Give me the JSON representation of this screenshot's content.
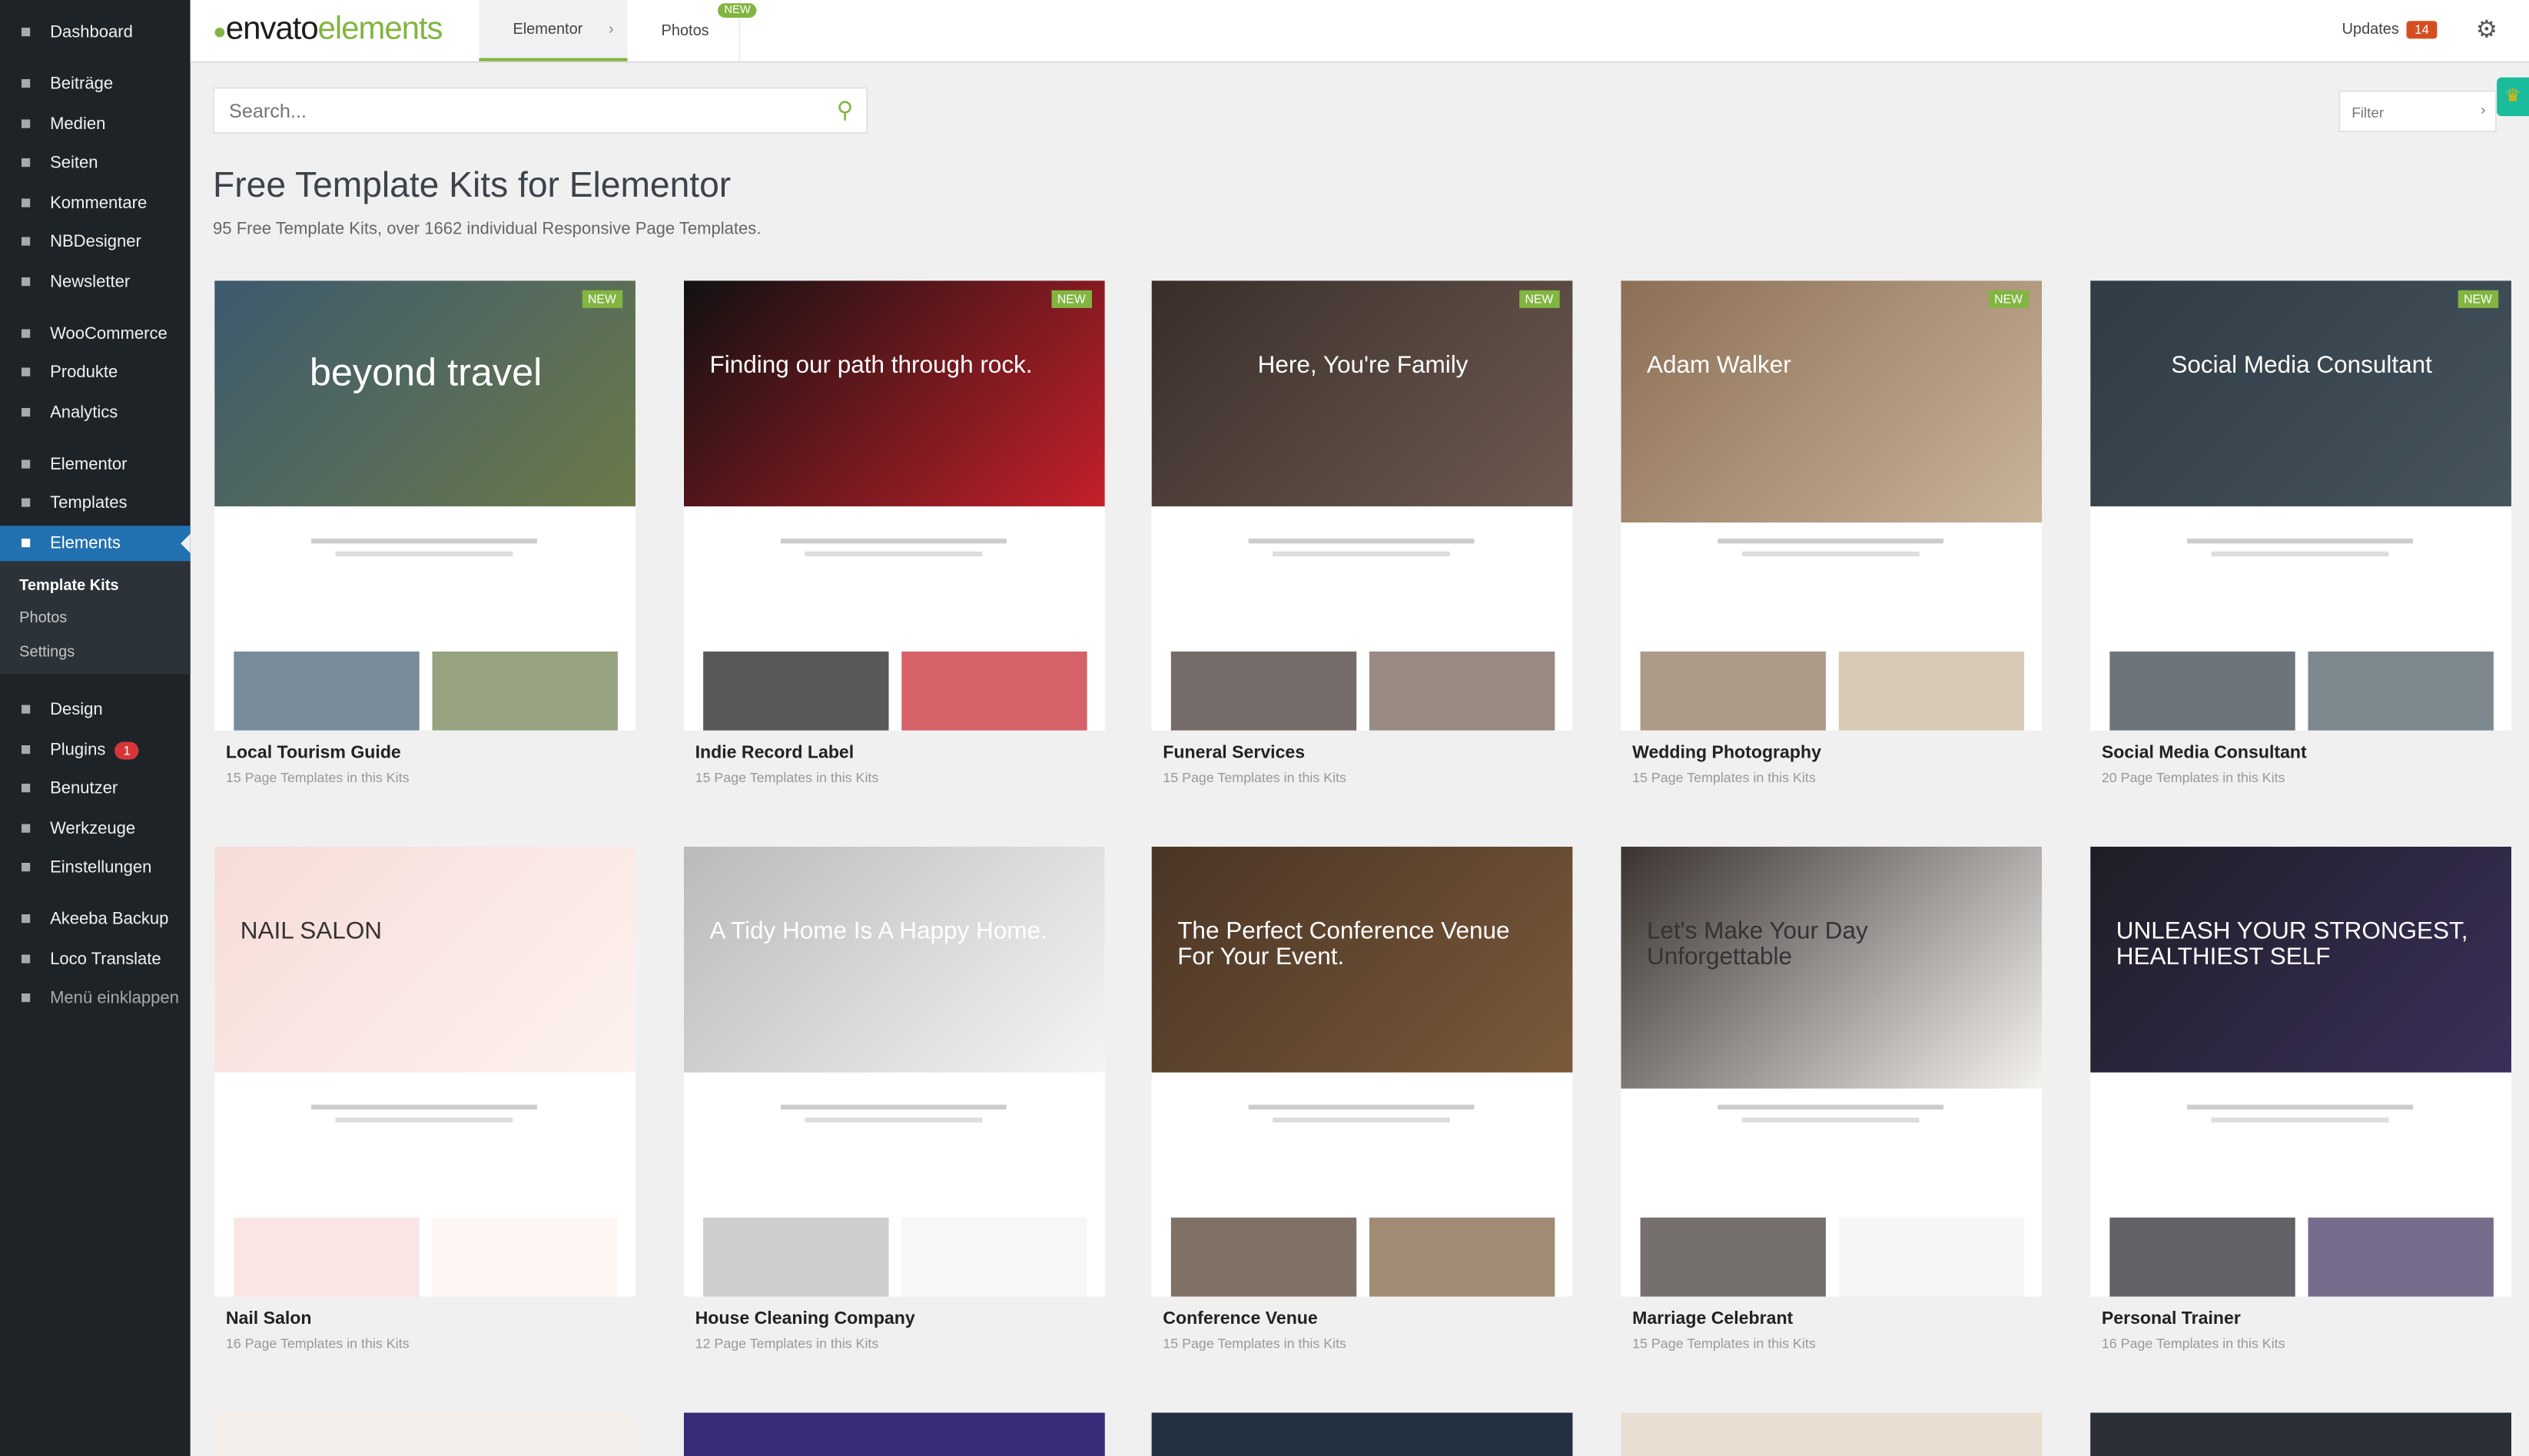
{
  "sidebar": {
    "items": [
      {
        "label": "Dashboard",
        "icon": "dashboard-icon"
      },
      {
        "label": "Beiträge",
        "icon": "pin-icon"
      },
      {
        "label": "Medien",
        "icon": "media-icon"
      },
      {
        "label": "Seiten",
        "icon": "pages-icon"
      },
      {
        "label": "Kommentare",
        "icon": "comment-icon"
      },
      {
        "label": "NBDesigner",
        "icon": "nb-icon"
      },
      {
        "label": "Newsletter",
        "icon": "mail-icon"
      },
      {
        "label": "WooCommerce",
        "icon": "woo-icon"
      },
      {
        "label": "Produkte",
        "icon": "box-icon"
      },
      {
        "label": "Analytics",
        "icon": "bar-chart-icon"
      },
      {
        "label": "Elementor",
        "icon": "elementor-icon"
      },
      {
        "label": "Templates",
        "icon": "folder-icon"
      },
      {
        "label": "Elements",
        "icon": "leaf-icon"
      },
      {
        "label": "Design",
        "icon": "brush-icon"
      },
      {
        "label": "Plugins",
        "icon": "plug-icon",
        "badge": "1"
      },
      {
        "label": "Benutzer",
        "icon": "user-icon"
      },
      {
        "label": "Werkzeuge",
        "icon": "wrench-icon"
      },
      {
        "label": "Einstellungen",
        "icon": "settings-icon"
      },
      {
        "label": "Akeeba Backup",
        "icon": "backup-icon"
      },
      {
        "label": "Loco Translate",
        "icon": "translate-icon"
      },
      {
        "label": "Menü einklappen",
        "icon": "collapse-icon"
      }
    ],
    "submenu": [
      "Template Kits",
      "Photos",
      "Settings"
    ]
  },
  "header": {
    "logo_a": "envato",
    "logo_b": "elements",
    "tabs": [
      "Elementor",
      "Photos"
    ],
    "new_badge": "NEW",
    "updates": "Updates",
    "updates_count": "14"
  },
  "search": {
    "placeholder": "Search..."
  },
  "filter": {
    "label": "Filter"
  },
  "page": {
    "title": "Free Template Kits for Elementor",
    "subtitle": "95 Free Template Kits, over 1662 individual Responsive Page Templates."
  },
  "cards": [
    {
      "title": "Local Tourism Guide",
      "count": "15 Page Templates in this Kits",
      "new": "NEW",
      "headline": "beyond travel",
      "colors": [
        "#3d5a6e",
        "#6b7a4a"
      ]
    },
    {
      "title": "Indie Record Label",
      "count": "15 Page Templates in this Kits",
      "new": "NEW",
      "headline": "Finding our path through rock.",
      "colors": [
        "#111111",
        "#c4202a"
      ]
    },
    {
      "title": "Funeral Services",
      "count": "15 Page Templates in this Kits",
      "new": "NEW",
      "headline": "Here, You're Family",
      "colors": [
        "#3a2e2a",
        "#6d5a50"
      ]
    },
    {
      "title": "Wedding Photography",
      "count": "15 Page Templates in this Kits",
      "new": "NEW",
      "headline": "Adam Walker",
      "colors": [
        "#8c6f55",
        "#c9b49a"
      ]
    },
    {
      "title": "Social Media Consultant",
      "count": "20 Page Templates in this Kits",
      "new": "NEW",
      "headline": "Social Media Consultant",
      "colors": [
        "#2f3b45",
        "#46545e"
      ]
    },
    {
      "title": "Nail Salon",
      "count": "16 Page Templates in this Kits",
      "headline": "NAIL SALON",
      "colors": [
        "#f6dcd8",
        "#fdf2ee"
      ]
    },
    {
      "title": "House Cleaning Company",
      "count": "12 Page Templates in this Kits",
      "headline": "A Tidy Home Is A Happy Home.",
      "colors": [
        "#b8bbb8",
        "#f4f4f4"
      ]
    },
    {
      "title": "Conference Venue",
      "count": "15 Page Templates in this Kits",
      "headline": "The Perfect Conference Venue For Your Event.",
      "colors": [
        "#4a3525",
        "#7a5a3a"
      ]
    },
    {
      "title": "Marriage Celebrant",
      "count": "15 Page Templates in this Kits",
      "headline": "Let's Make Your Day Unforgettable",
      "colors": [
        "#3a3330",
        "#f4f2ef"
      ]
    },
    {
      "title": "Personal Trainer",
      "count": "16 Page Templates in this Kits",
      "headline": "UNLEASH YOUR STRONGEST, HEALTHIEST SELF",
      "colors": [
        "#1e1e26",
        "#3b2f5a"
      ]
    }
  ]
}
